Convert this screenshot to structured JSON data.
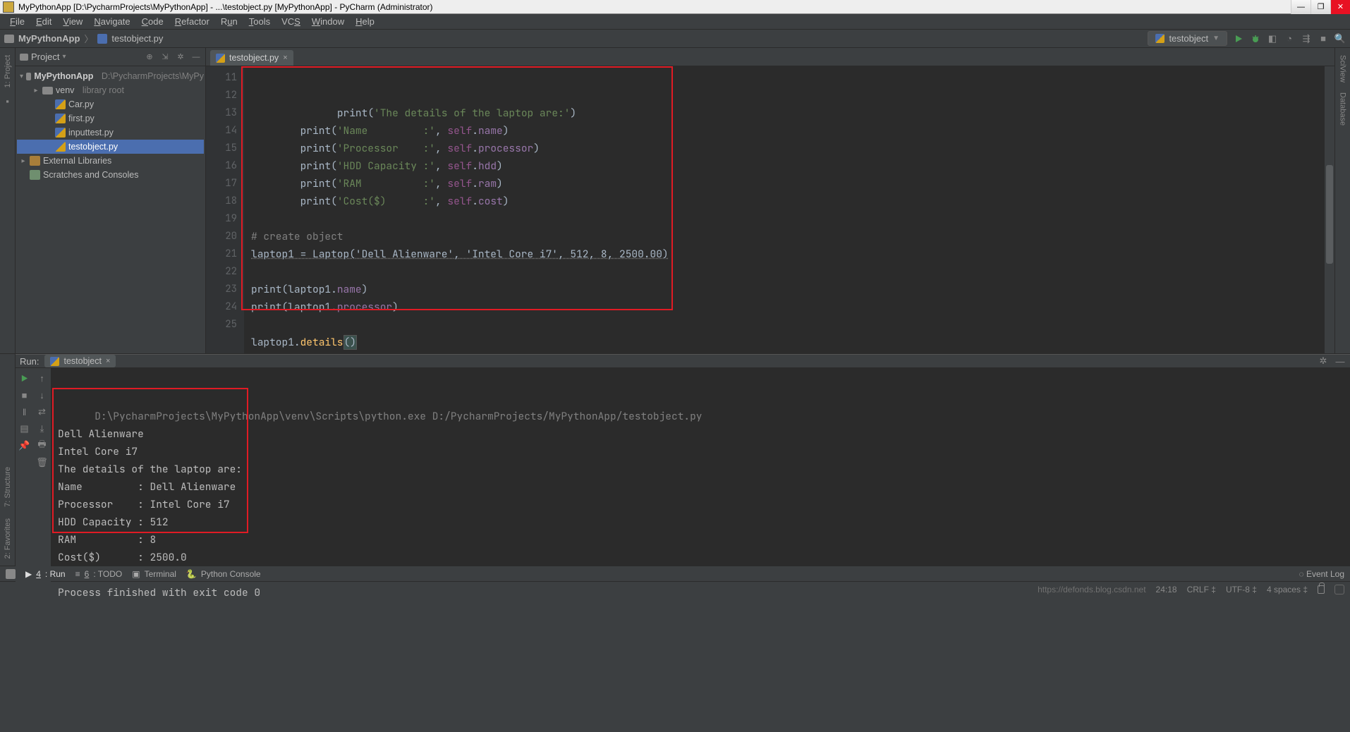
{
  "title": "MyPythonApp [D:\\PycharmProjects\\MyPythonApp] - ...\\testobject.py [MyPythonApp] - PyCharm (Administrator)",
  "menu": [
    "File",
    "Edit",
    "View",
    "Navigate",
    "Code",
    "Refactor",
    "Run",
    "Tools",
    "VCS",
    "Window",
    "Help"
  ],
  "breadcrumb": {
    "root": "MyPythonApp",
    "file": "testobject.py"
  },
  "runcfg": "testobject",
  "project_header": "Project",
  "tree": {
    "root_name": "MyPythonApp",
    "root_path": "D:\\PycharmProjects\\MyPy",
    "venv_name": "venv",
    "venv_hint": "library root",
    "files": [
      "Car.py",
      "first.py",
      "inputtest.py",
      "testobject.py"
    ],
    "ext_lib": "External Libraries",
    "scratch": "Scratches and Consoles"
  },
  "editor_tab": "testobject.py",
  "code_first_line": 11,
  "code": [
    {
      "indent": 8,
      "tokens": [
        [
          "id",
          "print"
        ],
        [
          "par",
          "("
        ],
        [
          "str",
          "'The details of the laptop are:'"
        ],
        [
          "par",
          ")"
        ]
      ]
    },
    {
      "indent": 8,
      "tokens": [
        [
          "id",
          "print"
        ],
        [
          "par",
          "("
        ],
        [
          "str",
          "'Name         :'"
        ],
        [
          "par",
          ", "
        ],
        [
          "self",
          "self"
        ],
        [
          "par",
          "."
        ],
        [
          "prop",
          "name"
        ],
        [
          "par",
          ")"
        ]
      ]
    },
    {
      "indent": 8,
      "tokens": [
        [
          "id",
          "print"
        ],
        [
          "par",
          "("
        ],
        [
          "str",
          "'Processor    :'"
        ],
        [
          "par",
          ", "
        ],
        [
          "self",
          "self"
        ],
        [
          "par",
          "."
        ],
        [
          "prop",
          "processor"
        ],
        [
          "par",
          ")"
        ]
      ]
    },
    {
      "indent": 8,
      "tokens": [
        [
          "id",
          "print"
        ],
        [
          "par",
          "("
        ],
        [
          "str",
          "'HDD Capacity :'"
        ],
        [
          "par",
          ", "
        ],
        [
          "self",
          "self"
        ],
        [
          "par",
          "."
        ],
        [
          "prop",
          "hdd"
        ],
        [
          "par",
          ")"
        ]
      ]
    },
    {
      "indent": 8,
      "tokens": [
        [
          "id",
          "print"
        ],
        [
          "par",
          "("
        ],
        [
          "str",
          "'RAM          :'"
        ],
        [
          "par",
          ", "
        ],
        [
          "self",
          "self"
        ],
        [
          "par",
          "."
        ],
        [
          "prop",
          "ram"
        ],
        [
          "par",
          ")"
        ]
      ]
    },
    {
      "indent": 8,
      "tokens": [
        [
          "id",
          "print"
        ],
        [
          "par",
          "("
        ],
        [
          "str",
          "'Cost($)      :'"
        ],
        [
          "par",
          ", "
        ],
        [
          "self",
          "self"
        ],
        [
          "par",
          "."
        ],
        [
          "prop",
          "cost"
        ],
        [
          "par",
          ")"
        ]
      ]
    },
    {
      "indent": 0,
      "tokens": []
    },
    {
      "indent": 0,
      "tokens": [
        [
          "cmt",
          "# create object"
        ]
      ]
    },
    {
      "indent": 0,
      "tokens": [
        [
          "under",
          "laptop1 = Laptop('Dell Alienware', 'Intel Core i7', 512, 8, 2500.00)"
        ]
      ]
    },
    {
      "indent": 0,
      "tokens": []
    },
    {
      "indent": 0,
      "tokens": [
        [
          "id",
          "print"
        ],
        [
          "par",
          "("
        ],
        [
          "obj",
          "laptop1"
        ],
        [
          "par",
          "."
        ],
        [
          "prop",
          "name"
        ],
        [
          "par",
          ")"
        ]
      ]
    },
    {
      "indent": 0,
      "tokens": [
        [
          "id",
          "print"
        ],
        [
          "par",
          "("
        ],
        [
          "obj",
          "laptop1"
        ],
        [
          "par",
          "."
        ],
        [
          "prop",
          "processor"
        ],
        [
          "par",
          ")"
        ]
      ]
    },
    {
      "indent": 0,
      "tokens": []
    },
    {
      "indent": 0,
      "tokens": [
        [
          "obj",
          "laptop1"
        ],
        [
          "par",
          "."
        ],
        [
          "fn",
          "details"
        ],
        [
          "lbr",
          "()"
        ]
      ]
    },
    {
      "indent": 0,
      "tokens": []
    }
  ],
  "run_label": "Run:",
  "run_tab": "testobject",
  "console_cmd": "D:\\PycharmProjects\\MyPythonApp\\venv\\Scripts\\python.exe D:/PycharmProjects/MyPythonApp/testobject.py",
  "console_out": [
    "Dell Alienware",
    "Intel Core i7",
    "The details of the laptop are:",
    "Name         : Dell Alienware",
    "Processor    : Intel Core i7",
    "HDD Capacity : 512",
    "RAM          : 8",
    "Cost($)      : 2500.0",
    "",
    "Process finished with exit code 0"
  ],
  "bottom_tabs": {
    "run": "4: Run",
    "todo": "6: TODO",
    "terminal": "Terminal",
    "pyconsole": "Python Console"
  },
  "eventlog": "Event Log",
  "status": {
    "pos": "24:18",
    "eol": "CRLF",
    "enc": "UTF-8",
    "indent": "4 spaces"
  },
  "watermark": "https://defonds.blog.csdn.net",
  "left_tools": {
    "project": "1: Project",
    "structure": "7: Structure",
    "favorites": "2: Favorites"
  },
  "right_tools": {
    "sciview": "SciView",
    "database": "Database"
  }
}
